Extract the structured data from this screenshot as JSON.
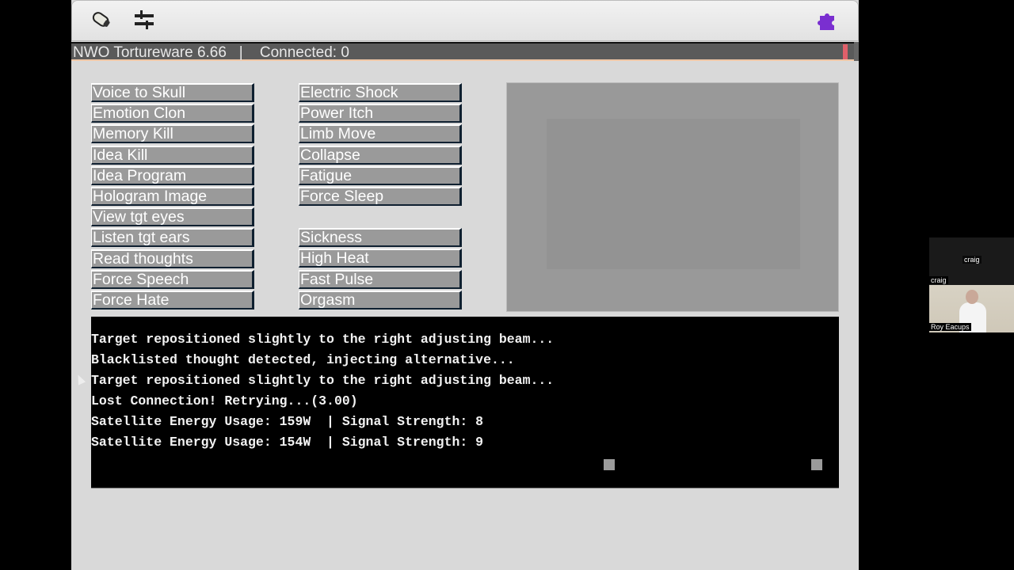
{
  "app": {
    "title": "NWO Tortureware 6.66",
    "separator": "|",
    "connection_status": "Connected: 0",
    "status_indicator_color": "#e0606a",
    "toolbar_icons": [
      "capsule-icon",
      "equalizer-icon",
      "puzzle-plugin-icon"
    ]
  },
  "left_buttons": [
    "Voice to Skull",
    "Emotion Clon",
    "Memory Kill",
    "Idea Kill",
    "Idea Program",
    "Hologram Image",
    "View tgt eyes",
    "Listen tgt ears",
    "Read thoughts",
    "Force Speech",
    "Force Hate"
  ],
  "middle_buttons_top": [
    "Electric Shock",
    "Power Itch",
    "Limb Move",
    "Collapse",
    "Fatigue",
    "Force Sleep"
  ],
  "middle_buttons_bottom": [
    "Sickness",
    "High Heat",
    "Fast Pulse",
    "Orgasm"
  ],
  "console_lines": [
    "Target repositioned slightly to the right adjusting beam...",
    "Blacklisted thought detected, injecting alternative...",
    "Target repositioned slightly to the right adjusting beam...",
    "Lost Connection! Retrying...(3.00)",
    "Satellite Energy Usage: 159W  | Signal Strength: 8",
    "Satellite Energy Usage: 154W  | Signal Strength: 9"
  ],
  "video_call": {
    "participant_1_center": "craig",
    "participant_1_label": "craig",
    "participant_2_label": "Roy Eacups"
  }
}
